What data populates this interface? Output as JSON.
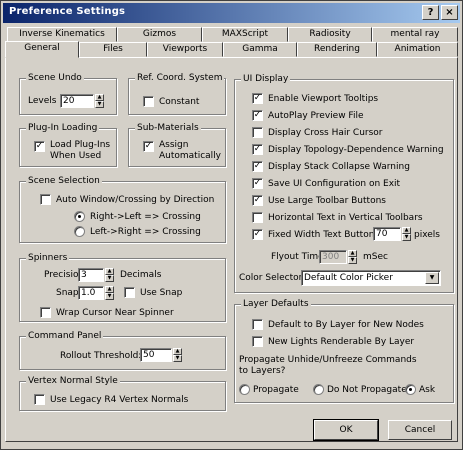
{
  "window": {
    "title": "Preference Settings",
    "help_glyph": "?",
    "close_glyph": "×"
  },
  "tabs_row1": [
    "Inverse Kinematics",
    "Gizmos",
    "MAXScript",
    "Radiosity",
    "mental ray"
  ],
  "tabs_row2": [
    "General",
    "Files",
    "Viewports",
    "Gamma",
    "Rendering",
    "Animation"
  ],
  "active_tab": "General",
  "scene_undo": {
    "title": "Scene Undo",
    "levels_label": "Levels",
    "levels_value": "20"
  },
  "ref_coord": {
    "title": "Ref. Coord. System",
    "constant_label": "Constant",
    "constant_checked": false
  },
  "plugin_loading": {
    "title": "Plug-In Loading",
    "load_label_1": "Load Plug-Ins",
    "load_label_2": "When Used",
    "checked": true
  },
  "sub_materials": {
    "title": "Sub-Materials",
    "assign_label_1": "Assign",
    "assign_label_2": "Automatically",
    "checked": true
  },
  "scene_selection": {
    "title": "Scene Selection",
    "auto_window_label": "Auto Window/Crossing by Direction",
    "auto_window_checked": false,
    "right_left_label": "Right->Left => Crossing",
    "left_right_label": "Left->Right => Crossing",
    "selected": "right_left"
  },
  "spinners": {
    "title": "Spinners",
    "precision_label": "Precision:",
    "precision_value": "3",
    "decimals_label": "Decimals",
    "snap_label": "Snap:",
    "snap_value": "1.0",
    "use_snap_label": "Use Snap",
    "use_snap_checked": false,
    "wrap_label": "Wrap Cursor Near Spinner",
    "wrap_checked": false
  },
  "command_panel": {
    "title": "Command Panel",
    "rollout_label": "Rollout Threshold:",
    "rollout_value": "50"
  },
  "vertex_normal": {
    "title": "Vertex Normal Style",
    "legacy_label": "Use Legacy R4 Vertex Normals",
    "legacy_checked": false
  },
  "ui_display": {
    "title": "UI Display",
    "options": [
      {
        "label": "Enable Viewport Tooltips",
        "checked": true
      },
      {
        "label": "AutoPlay Preview File",
        "checked": true
      },
      {
        "label": "Display Cross Hair Cursor",
        "checked": false
      },
      {
        "label": "Display Topology-Dependence Warning",
        "checked": true
      },
      {
        "label": "Display Stack Collapse Warning",
        "checked": true
      },
      {
        "label": "Save UI Configuration on Exit",
        "checked": true
      },
      {
        "label": "Use Large Toolbar Buttons",
        "checked": true
      },
      {
        "label": "Horizontal Text in Vertical Toolbars",
        "checked": false
      },
      {
        "label": "Fixed Width Text Buttons:",
        "checked": true
      }
    ],
    "fixed_width_value": "70",
    "pixels_label": "pixels",
    "flyout_label": "Flyout Time:",
    "flyout_value": "300",
    "msec_label": "mSec",
    "color_selector_label": "Color Selector:",
    "color_selector_value": "Default Color Picker"
  },
  "layer_defaults": {
    "title": "Layer Defaults",
    "default_label": "Default to By Layer for New Nodes",
    "default_checked": false,
    "new_lights_label": "New Lights Renderable By Layer",
    "new_lights_checked": false,
    "propagate_question_1": "Propagate Unhide/Unfreeze Commands",
    "propagate_question_2": "to Layers?",
    "propagate_label": "Propagate",
    "do_not_propagate_label": "Do Not Propagate",
    "ask_label": "Ask",
    "selected": "ask"
  },
  "buttons": {
    "ok": "OK",
    "cancel": "Cancel"
  },
  "colors": {
    "title_start": "#0a246a",
    "title_end": "#a6caf0",
    "face": "#d4d0c8"
  }
}
